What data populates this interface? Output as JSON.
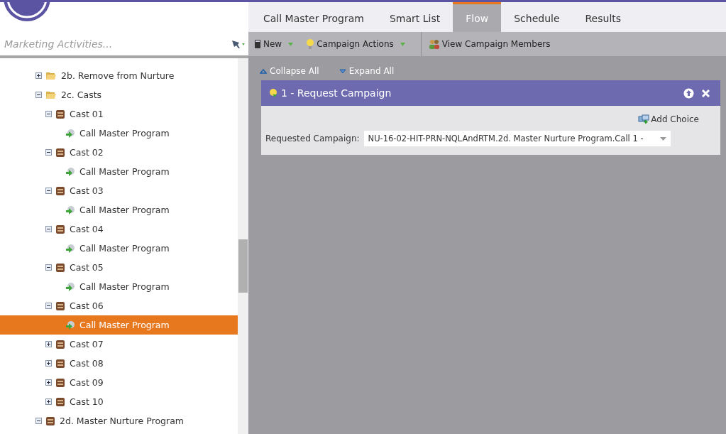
{
  "search": {
    "placeholder": "Marketing Activities..."
  },
  "tree": [
    {
      "label": "2b. Remove from Nurture",
      "kind": "folder",
      "expanded": false,
      "selected": false
    },
    {
      "label": "2c. Casts",
      "kind": "folder",
      "expanded": true,
      "selected": false,
      "children": [
        {
          "label": "Cast 01",
          "kind": "program",
          "expanded": true,
          "selected": false,
          "children": [
            {
              "label": "Call Master Program",
              "kind": "campaign",
              "selected": false
            }
          ]
        },
        {
          "label": "Cast 02",
          "kind": "program",
          "expanded": true,
          "selected": false,
          "children": [
            {
              "label": "Call Master Program",
              "kind": "campaign",
              "selected": false
            }
          ]
        },
        {
          "label": "Cast 03",
          "kind": "program",
          "expanded": true,
          "selected": false,
          "children": [
            {
              "label": "Call Master Program",
              "kind": "campaign",
              "selected": false
            }
          ]
        },
        {
          "label": "Cast 04",
          "kind": "program",
          "expanded": true,
          "selected": false,
          "children": [
            {
              "label": "Call Master Program",
              "kind": "campaign",
              "selected": false
            }
          ]
        },
        {
          "label": "Cast 05",
          "kind": "program",
          "expanded": true,
          "selected": false,
          "children": [
            {
              "label": "Call Master Program",
              "kind": "campaign",
              "selected": false
            }
          ]
        },
        {
          "label": "Cast 06",
          "kind": "program",
          "expanded": true,
          "selected": false,
          "children": [
            {
              "label": "Call Master Program",
              "kind": "campaign",
              "selected": true
            }
          ]
        },
        {
          "label": "Cast 07",
          "kind": "program",
          "expanded": false,
          "selected": false
        },
        {
          "label": "Cast 08",
          "kind": "program",
          "expanded": false,
          "selected": false
        },
        {
          "label": "Cast 09",
          "kind": "program",
          "expanded": false,
          "selected": false
        },
        {
          "label": "Cast 10",
          "kind": "program",
          "expanded": false,
          "selected": false
        }
      ]
    },
    {
      "label": "2d. Master Nurture Program",
      "kind": "program",
      "expanded": true,
      "selected": false
    }
  ],
  "tabs": [
    {
      "label": "Call Master Program",
      "selected": false
    },
    {
      "label": "Smart List",
      "selected": false
    },
    {
      "label": "Flow",
      "selected": true
    },
    {
      "label": "Schedule",
      "selected": false
    },
    {
      "label": "Results",
      "selected": false
    }
  ],
  "toolbar": [
    {
      "label": "New",
      "kind": "new",
      "dropdown": true
    },
    {
      "label": "Campaign Actions",
      "kind": "actions",
      "dropdown": true
    },
    {
      "label": "View Campaign Members",
      "kind": "members",
      "dropdown": false
    }
  ],
  "flow_controls": {
    "collapse": "Collapse All",
    "expand": "Expand All"
  },
  "step": {
    "title": "1 - Request Campaign",
    "add_choice": "Add Choice",
    "field_label": "Requested Campaign:",
    "field_value": "NU-16-02-HIT-PRN-NQLAndRTM.2d. Master Nurture Program.Call 1 -"
  }
}
